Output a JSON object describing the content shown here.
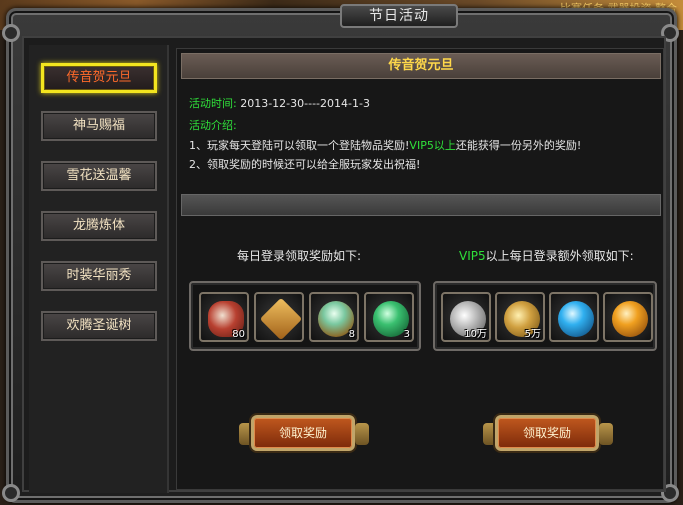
{
  "background": {
    "top_text": "比赛任务 武器投资 整合"
  },
  "window": {
    "title": "节日活动"
  },
  "sidebar": {
    "items": [
      {
        "label": "传音贺元旦",
        "active": true
      },
      {
        "label": "神马赐福",
        "active": false
      },
      {
        "label": "雪花送温馨",
        "active": false
      },
      {
        "label": "龙腾炼体",
        "active": false
      },
      {
        "label": "时装华丽秀",
        "active": false
      },
      {
        "label": "欢腾圣诞树",
        "active": false
      }
    ]
  },
  "event": {
    "title": "传音贺元旦",
    "time_label": "活动时间:",
    "time_value": "2013-12-30----2014-1-3",
    "intro_label": "活动介绍:",
    "line1_pre": "1、玩家每天登陆可以领取一个登陆物品奖励!",
    "line1_vip": "VIP5以上",
    "line1_post": "还能获得一份另外的奖励!",
    "line2": "2、领取奖励的时候还可以给全服玩家发出祝福!"
  },
  "daily_rewards": {
    "heading": "每日登录领取奖励如下:",
    "items": [
      {
        "icon": "red-rune-stone-icon",
        "count": "80"
      },
      {
        "icon": "treasure-scroll-icon",
        "count": ""
      },
      {
        "icon": "jade-orb-icon",
        "count": "8"
      },
      {
        "icon": "green-pearl-icon",
        "count": "3"
      }
    ],
    "button": "领取奖励"
  },
  "vip_rewards": {
    "heading_vip": "VIP5",
    "heading_rest": "以上每日登录额外领取如下:",
    "items": [
      {
        "icon": "silver-coins-icon",
        "count": "10万"
      },
      {
        "icon": "gold-coins-icon",
        "count": "5万"
      },
      {
        "icon": "blue-pearl-icon",
        "count": ""
      },
      {
        "icon": "orange-pearl-icon",
        "count": ""
      }
    ],
    "button": "领取奖励"
  },
  "colors": {
    "accent_green": "#2fe03a",
    "title_gold": "#ffd84a",
    "active_border": "#f3e51f",
    "active_text": "#ff6a2a",
    "button_orange": "#c0581e"
  }
}
